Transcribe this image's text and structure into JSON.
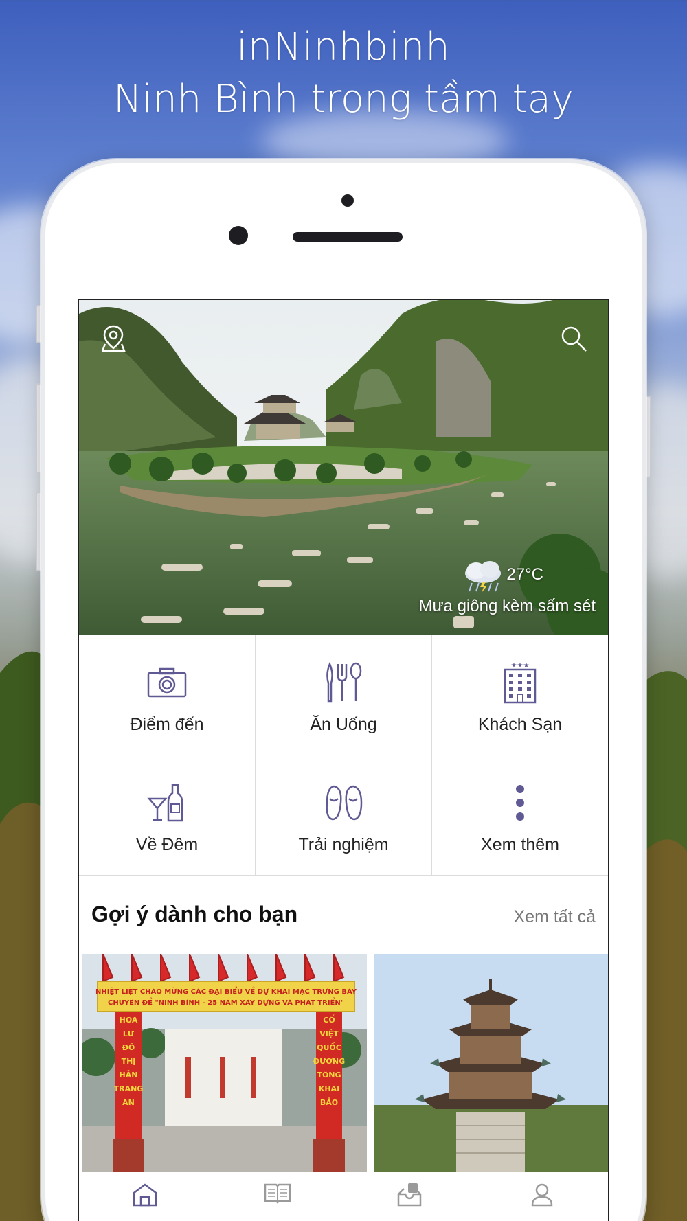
{
  "headline": {
    "app_name": "inNinhbinh",
    "tagline": "Ninh Bình trong tầm tay"
  },
  "hero": {
    "location_icon": "location-pin-icon",
    "search_icon": "search-icon",
    "weather": {
      "icon": "thunderstorm-cloud-icon",
      "temperature": "27°C",
      "description": "Mưa giông kèm sấm sét"
    }
  },
  "categories": [
    {
      "label": "Điểm đến",
      "icon": "camera-icon"
    },
    {
      "label": "Ăn Uống",
      "icon": "utensils-icon"
    },
    {
      "label": "Khách Sạn",
      "icon": "hotel-icon"
    },
    {
      "label": "Về Đêm",
      "icon": "cocktail-bottle-icon"
    },
    {
      "label": "Trải nghiệm",
      "icon": "footprints-icon"
    },
    {
      "label": "Xem thêm",
      "icon": "more-vertical-icon"
    }
  ],
  "suggestions": {
    "title": "Gợi ý dành cho bạn",
    "see_all": "Xem tất cả",
    "cards": [
      {
        "banner_top": "NHIỆT LIỆT CHÀO MỪNG CÁC ĐẠI BIỂU VỀ DỰ KHAI MẠC TRƯNG BÀY",
        "banner_bottom": "CHUYÊN ĐỀ \"NINH BÌNH - 25 NĂM XÂY DỰNG VÀ PHÁT TRIỂN\"",
        "left_column": "HOA LƯ ĐÔ THỊ HẢN TRANG AN",
        "right_column": "CỐ VIỆT QUỐC ĐƯƠNG TÔNG KHAI BẢO"
      },
      {}
    ]
  },
  "nav": [
    {
      "icon": "home-icon",
      "active": true
    },
    {
      "icon": "book-icon",
      "active": false
    },
    {
      "icon": "inbox-icon",
      "active": false
    },
    {
      "icon": "user-icon",
      "active": false
    }
  ],
  "colors": {
    "icon_purple": "#5f5a93",
    "nav_gray": "#9a9a9a",
    "text_dark": "#222222",
    "link_gray": "#777777"
  }
}
